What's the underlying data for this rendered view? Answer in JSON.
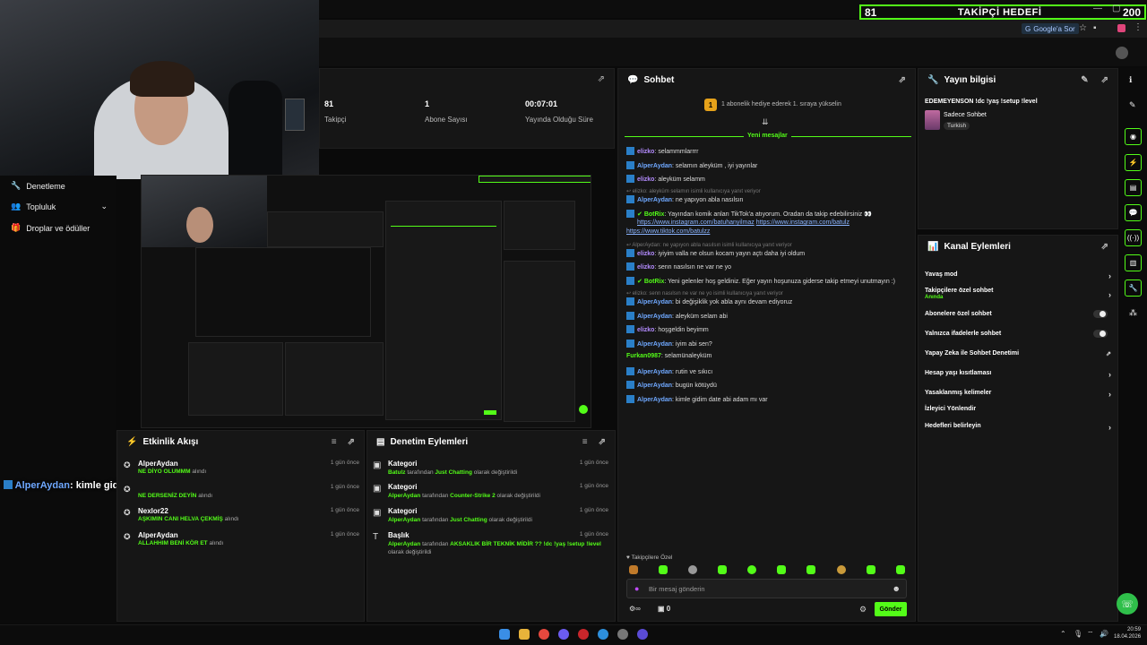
{
  "goal": {
    "current": "81",
    "title": "TAKİPÇİ HEDEFİ",
    "target": "200"
  },
  "browser": {
    "google_sor": "Google'a Sor"
  },
  "stats": [
    {
      "value": "81",
      "label": "Takipçi"
    },
    {
      "value": "1",
      "label": "Abone Sayısı"
    },
    {
      "value": "00:07:01",
      "label": "Yayında Olduğu Süre"
    }
  ],
  "sidebar": {
    "items": [
      "Denetleme",
      "Topluluk",
      "Droplar ve ödüller"
    ]
  },
  "overlay": {
    "user": "AlperAydan",
    "text": ": kimle gidim date abi adam mı var"
  },
  "activity": {
    "title": "Etkinlik Akışı",
    "items": [
      {
        "name": "AlperAydan",
        "item": "NE DİYO OLUMMM",
        "suffix": "alındı",
        "time": "1 gün önce"
      },
      {
        "name": "",
        "item": "NE DERSENİZ DEYİN",
        "suffix": "alındı",
        "time": "1 gün önce"
      },
      {
        "name": "Nexlor22",
        "item": "AŞKIMIN CANI HELVA ÇEKMİŞ",
        "suffix": "alındı",
        "time": "1 gün önce"
      },
      {
        "name": "AlperAydan",
        "item": "ALLAHHIM BENİ KÖR ET",
        "suffix": "alındı",
        "time": "1 gün önce"
      }
    ]
  },
  "moderation": {
    "title": "Denetim Eylemleri",
    "items": [
      {
        "type": "Kategori",
        "by": "Batulz",
        "mid": "tarafından",
        "value": "Just Chatting",
        "end": "olarak değiştirildi",
        "time": "1 gün önce"
      },
      {
        "type": "Kategori",
        "by": "AlperAydan",
        "mid": "tarafından",
        "value": "Counter-Strike 2",
        "end": "olarak değiştirildi",
        "time": "1 gün önce"
      },
      {
        "type": "Kategori",
        "by": "AlperAydan",
        "mid": "tarafından",
        "value": "Just Chatting",
        "end": "olarak değiştirildi",
        "time": "1 gün önce"
      },
      {
        "type": "Başlık",
        "by": "AlperAydan",
        "mid": "tarafından",
        "value": "AKSAKLIK BİR TEKNİK MİDİR ?? !dc !yaş !setup !level",
        "end": "olarak değiştirildi",
        "time": "1 gün önce"
      }
    ]
  },
  "chat": {
    "title": "Sohbet",
    "pinned": "1 abonelik hediye ederek 1. sıraya yükselin",
    "new_messages": "Yeni mesajlar",
    "messages": [
      {
        "user": "elizko",
        "text": ": selammmlarrrr"
      },
      {
        "user": "AlperAydan",
        "text": ": selamın aleyküm , iyi yayınlar"
      },
      {
        "user": "elizko",
        "text": ": aleyküm selamm"
      },
      {
        "reply": "elizko: aleyküm selamın isimli kullanıcıya yanıt veriyor"
      },
      {
        "user": "AlperAydan",
        "text": ": ne yapıyon abla nasılsın"
      },
      {
        "user": "BotRix",
        "text": ": Yayından komik anları TikTok'a atıyorum. Oradan da takip edebilirsiniz 👀"
      },
      {
        "link1": "https://www.instagram.com/batuhanyilmaz",
        "link2": "https://www.instagram.com/batulz",
        "link3": "https://www.tiktok.com/batulzz"
      },
      {
        "reply": "AlperAydan: ne yapıyon abla nasılsın isimli kullanıcıya yanıt veriyor"
      },
      {
        "user": "elizko",
        "text": ": iyiyim valla ne olsun kocam yayın açtı daha iyi oldum"
      },
      {
        "user": "elizko",
        "text": ": senn nasılsın ne var ne yo"
      },
      {
        "user": "BotRix",
        "text": ": Yeni gelenler hoş geldiniz. Eğer yayın hoşunuza giderse takip etmeyi unutmayın :)"
      },
      {
        "reply": "elizko: senn nasılsın ne var ne yo isimli kullanıcıya yanıt veriyor"
      },
      {
        "user": "AlperAydan",
        "text": ": bi değişiklik yok abla aynı devam ediyoruz"
      },
      {
        "user": "AlperAydan",
        "text": ": aleyküm selam abi"
      },
      {
        "user": "elizko",
        "text": ": hoşgeldin beyimm"
      },
      {
        "user": "AlperAydan",
        "text": ": iyim abi sen?"
      },
      {
        "user": "Furkan0987",
        "text": ": selamünaleyküm"
      },
      {
        "user": "AlperAydan",
        "text": ": rutin ve sıkıcı"
      },
      {
        "user": "AlperAydan",
        "text": ": bugün kötüydü"
      },
      {
        "user": "AlperAydan",
        "text": ": kimle gidim date abi adam mı var"
      }
    ],
    "followers_only": "Takipçilere Özel",
    "input_placeholder": "Bir mesaj gönderin",
    "viewer_count": "0",
    "send": "Gönder"
  },
  "stream_info": {
    "title": "Yayın bilgisi",
    "stream_title": "EDEMEYENSON !dc !yaş !setup !level",
    "category": "Sadece Sohbet",
    "tag": "Turkish"
  },
  "channel_actions": {
    "title": "Kanal Eylemleri",
    "items": [
      {
        "label": "Yavaş mod",
        "sub": "",
        "control": "chevron"
      },
      {
        "label": "Takipçilere özel sohbet",
        "sub": "Anında",
        "control": "chevron"
      },
      {
        "label": "Abonelere özel sohbet",
        "sub": "",
        "control": "toggle"
      },
      {
        "label": "Yalnızca ifadelerle sohbet",
        "sub": "",
        "control": "toggle"
      },
      {
        "label": "Yapay Zeka ile Sohbet Denetimi",
        "sub": "",
        "control": "external"
      },
      {
        "label": "Hesap yaşı kısıtlaması",
        "sub": "",
        "control": "chevron"
      },
      {
        "label": "Yasaklanmış kelimeler",
        "sub": "",
        "control": "chevron"
      },
      {
        "label": "İzleyici Yönlendir",
        "sub": "",
        "control": "none"
      },
      {
        "label": "Hedefleri belirleyin",
        "sub": "",
        "control": "chevron"
      }
    ]
  },
  "clock": {
    "time": "20:59",
    "date": "18.04.2026"
  },
  "colors": {
    "accent": "#53fc18",
    "panel": "#161616",
    "bg": "#0a0a0a"
  }
}
